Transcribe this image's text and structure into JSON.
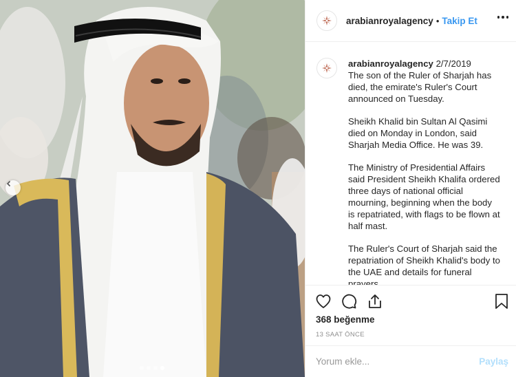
{
  "post": {
    "username": "arabianroyalagency",
    "separator": "•",
    "follow_label": "Takip Et",
    "more_icon": "ellipsis-icon",
    "avatar_icon": "logo-avatar-icon"
  },
  "caption": {
    "username": "arabianroyalagency",
    "date": "2/7/2019",
    "first_line": "The son of the Ruler of Sharjah has died, the emirate's Ruler's Court announced on Tuesday.",
    "paragraphs": [
      "Sheikh Khalid bin Sultan Al Qasimi died on Monday in London, said Sharjah Media Office. He was 39.",
      "The Ministry of Presidential Affairs said President Sheikh Khalifa ordered three days of national official mourning, beginning when the body is repatriated, with flags to be flown at half mast.",
      "The Ruler's Court of Sharjah said the repatriation of Sheikh Khalid's body to the UAE and details for funeral prayers"
    ]
  },
  "actions": {
    "like_icon": "heart-icon",
    "comment_icon": "comment-icon",
    "share_icon": "share-icon",
    "save_icon": "bookmark-icon"
  },
  "likes": "368 beğenme",
  "time_ago": "13 SAAT ÖNCE",
  "comment_box": {
    "placeholder": "Yorum ekle...",
    "post_label": "Paylaş"
  },
  "carousel": {
    "total": 4,
    "active_index": 3
  },
  "colors": {
    "link_blue": "#3897f0",
    "post_disabled": "#b2dffc",
    "muted_text": "#8e8e8e",
    "border": "#efefef"
  }
}
